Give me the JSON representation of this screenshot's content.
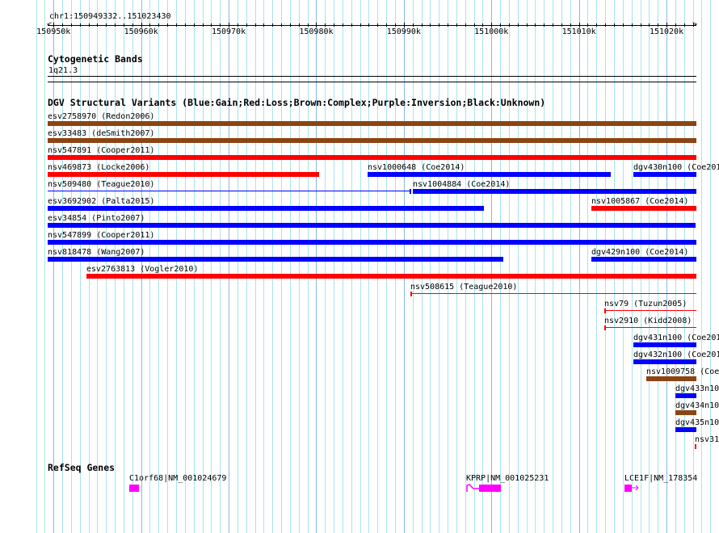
{
  "view": {
    "location": "chr1:150949332..151023430",
    "start_kb": 150949.332,
    "end_kb": 151023.43
  },
  "ruler": {
    "labels": [
      "150950k",
      "150960k",
      "150970k",
      "150980k",
      "150990k",
      "151000k",
      "151010k",
      "151020k"
    ],
    "label_kb": [
      150950,
      150960,
      150970,
      150980,
      150990,
      151000,
      151010,
      151020
    ]
  },
  "cytobands": {
    "title": "Cytogenetic Bands",
    "band": "1q21.3"
  },
  "colors": {
    "gain": "#0000ff",
    "loss": "#ff0000",
    "complex": "#8b4513",
    "gene": "#ff00ff",
    "grid": "#a8e4ec"
  },
  "dgv": {
    "title": "DGV Structural Variants (Blue:Gain;Red:Loss;Brown:Complex;Purple:Inversion;Black:Unknown)",
    "rows": [
      [
        {
          "label": "esv2758970 (Redon2006)",
          "type": "complex",
          "start": 150949.332,
          "end": 151023.43
        }
      ],
      [
        {
          "label": "esv33483 (deSmith2007)",
          "type": "complex",
          "start": 150949.332,
          "end": 151023.43
        }
      ],
      [
        {
          "label": "nsv547891 (Cooper2011)",
          "type": "loss",
          "start": 150949.332,
          "end": 151023.43
        }
      ],
      [
        {
          "label": "nsv469873 (Locke2006)",
          "type": "loss",
          "start": 150949.332,
          "end": 150980.33
        },
        {
          "label": "nsv1000648 (Coe2014)",
          "type": "gain",
          "start": 150985.86,
          "end": 151013.63
        },
        {
          "label": "dgv430n100 (Coe201",
          "type": "gain",
          "start": 151016.21,
          "end": 151023.43
        }
      ],
      [
        {
          "label": "nsv509480 (Teague2010)",
          "type": "gain",
          "start": 150949.332,
          "end": 150990.75,
          "thin": true,
          "tick": "end"
        },
        {
          "label": "nsv1004884 (Coe2014)",
          "type": "gain",
          "start": 150991.03,
          "end": 151023.43
        }
      ],
      [
        {
          "label": "esv3692902 (Palta2015)",
          "type": "gain",
          "start": 150949.332,
          "end": 150999.15
        },
        {
          "label": "nsv1005867 (Coe2014)",
          "type": "loss",
          "start": 151011.41,
          "end": 151023.43
        }
      ],
      [
        {
          "label": "esv34854 (Pinto2007)",
          "type": "gain",
          "start": 150949.332,
          "end": 151023.3
        }
      ],
      [
        {
          "label": "nsv547899 (Cooper2011)",
          "type": "gain",
          "start": 150949.332,
          "end": 151023.43
        }
      ],
      [
        {
          "label": "nsv818478 (Wang2007)",
          "type": "gain",
          "start": 150949.332,
          "end": 151001.36
        },
        {
          "label": "dgv429n100 (Coe2014)",
          "type": "gain",
          "start": 151011.41,
          "end": 151023.43
        }
      ],
      [
        {
          "label": "esv2763813 (Vogler2010)",
          "type": "loss",
          "start": 150953.76,
          "end": 151023.43
        }
      ],
      [
        {
          "label": "nsv508615 (Teague2010)",
          "type": "loss",
          "start": 150990.75,
          "end": 151023.43,
          "thin": true,
          "tick": "start"
        }
      ],
      [
        {
          "label": "nsv79 (Tuzun2005)",
          "type": "loss",
          "start": 151012.89,
          "end": 151023.43,
          "thin": true,
          "tick": "start"
        }
      ],
      [
        {
          "label": "nsv2910 (Kidd2008)",
          "type": "loss",
          "start": 151012.89,
          "end": 151023.43,
          "thin": true,
          "tick": "start"
        }
      ],
      [
        {
          "label": "dgv431n100 (Coe201",
          "type": "gain",
          "start": 151016.21,
          "end": 151023.43
        }
      ],
      [
        {
          "label": "dgv432n100 (Coe201",
          "type": "gain",
          "start": 151016.21,
          "end": 151023.43
        }
      ],
      [
        {
          "label": "nsv1009758 (Coe",
          "type": "complex",
          "start": 151017.69,
          "end": 151023.43
        }
      ],
      [
        {
          "label": "dgv433n10",
          "type": "gain",
          "start": 151021.01,
          "end": 151023.43
        }
      ],
      [
        {
          "label": "dgv434n10",
          "type": "complex",
          "start": 151021.01,
          "end": 151023.43
        }
      ],
      [
        {
          "label": "dgv435n10",
          "type": "gain",
          "start": 151021.01,
          "end": 151023.43
        }
      ],
      [
        {
          "label": "nsv31",
          "type": "loss",
          "start": 151023.22,
          "end": 151023.43
        }
      ]
    ]
  },
  "refseq": {
    "title": "RefSeq Genes",
    "genes": [
      {
        "label": "C1orf68|NM_001024679",
        "start": 150958.65,
        "end": 150959.76
      },
      {
        "label": "KPRP|NM_001025231",
        "start": 150998.59,
        "end": 151001.08,
        "intron_start": 150997.12
      },
      {
        "label": "LCE1F|NM_178354",
        "start": 151015.2,
        "end": 151016.03,
        "arrow": true
      }
    ]
  }
}
